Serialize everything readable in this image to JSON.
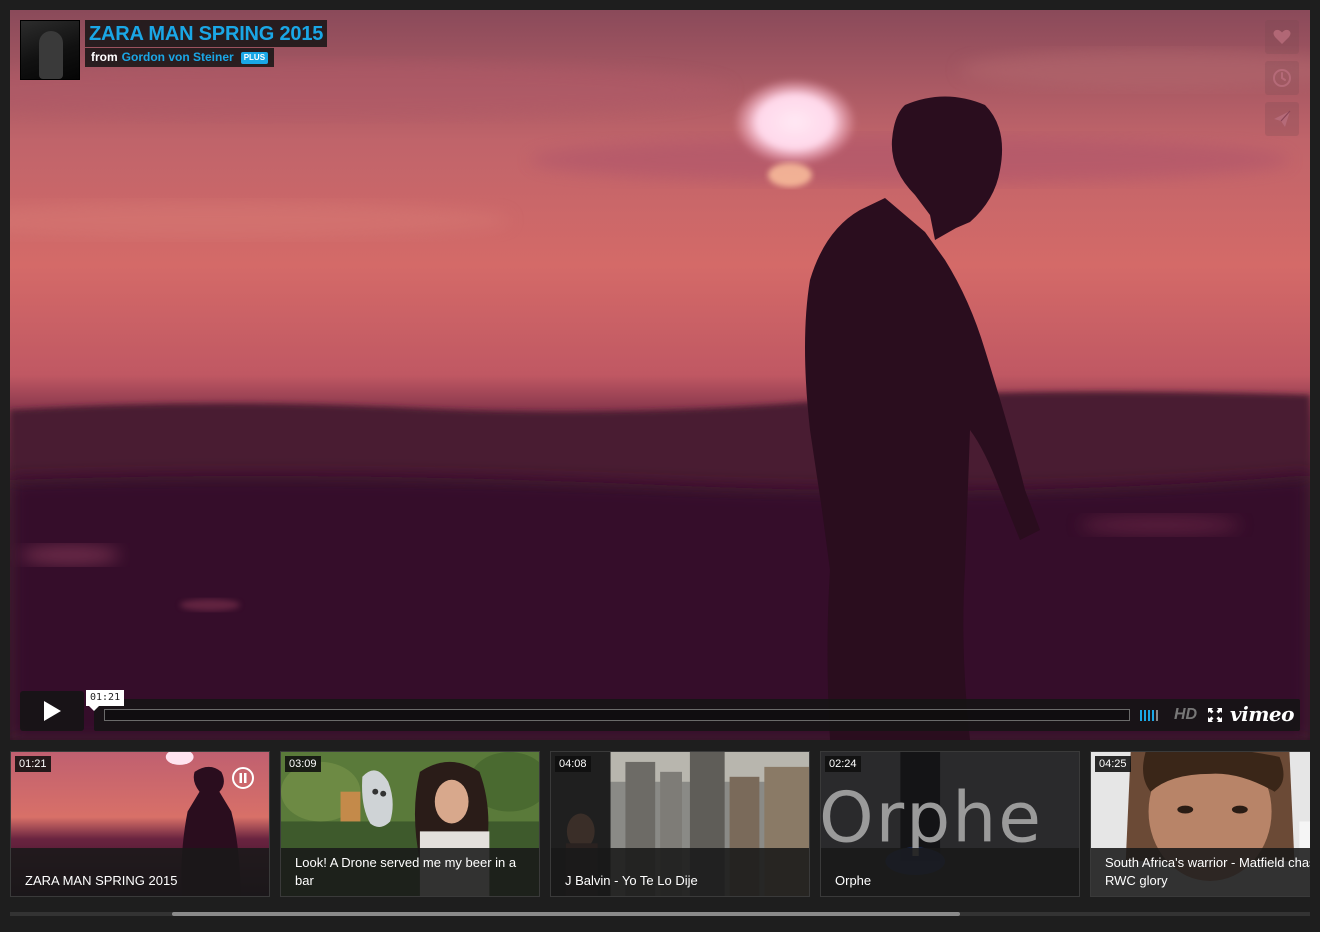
{
  "video": {
    "title": "ZARA MAN SPRING 2015",
    "from_label": "from",
    "author": "Gordon von Steiner",
    "badge": "PLUS",
    "current_time": "01:21",
    "progress": 0.0,
    "hd_label": "HD",
    "brand": "vimeo",
    "accent_color": "#1aa7e6"
  },
  "side_actions": [
    {
      "name": "like",
      "icon": "heart-icon"
    },
    {
      "name": "watch-later",
      "icon": "clock-icon"
    },
    {
      "name": "share",
      "icon": "paper-plane-icon"
    }
  ],
  "thumbnails": [
    {
      "duration": "01:21",
      "title": "ZARA MAN SPRING 2015",
      "playing": true
    },
    {
      "duration": "03:09",
      "title": "Look! A Drone served me my beer in a bar",
      "playing": false
    },
    {
      "duration": "04:08",
      "title": "J Balvin - Yo Te Lo Dije",
      "playing": false
    },
    {
      "duration": "02:24",
      "title": "Orphe",
      "playing": false
    },
    {
      "duration": "04:25",
      "title": "South Africa's warrior - Matfield chas RWC glory",
      "playing": false
    }
  ],
  "thumbnail_art_text": {
    "orphe_logo": "Orphe"
  }
}
